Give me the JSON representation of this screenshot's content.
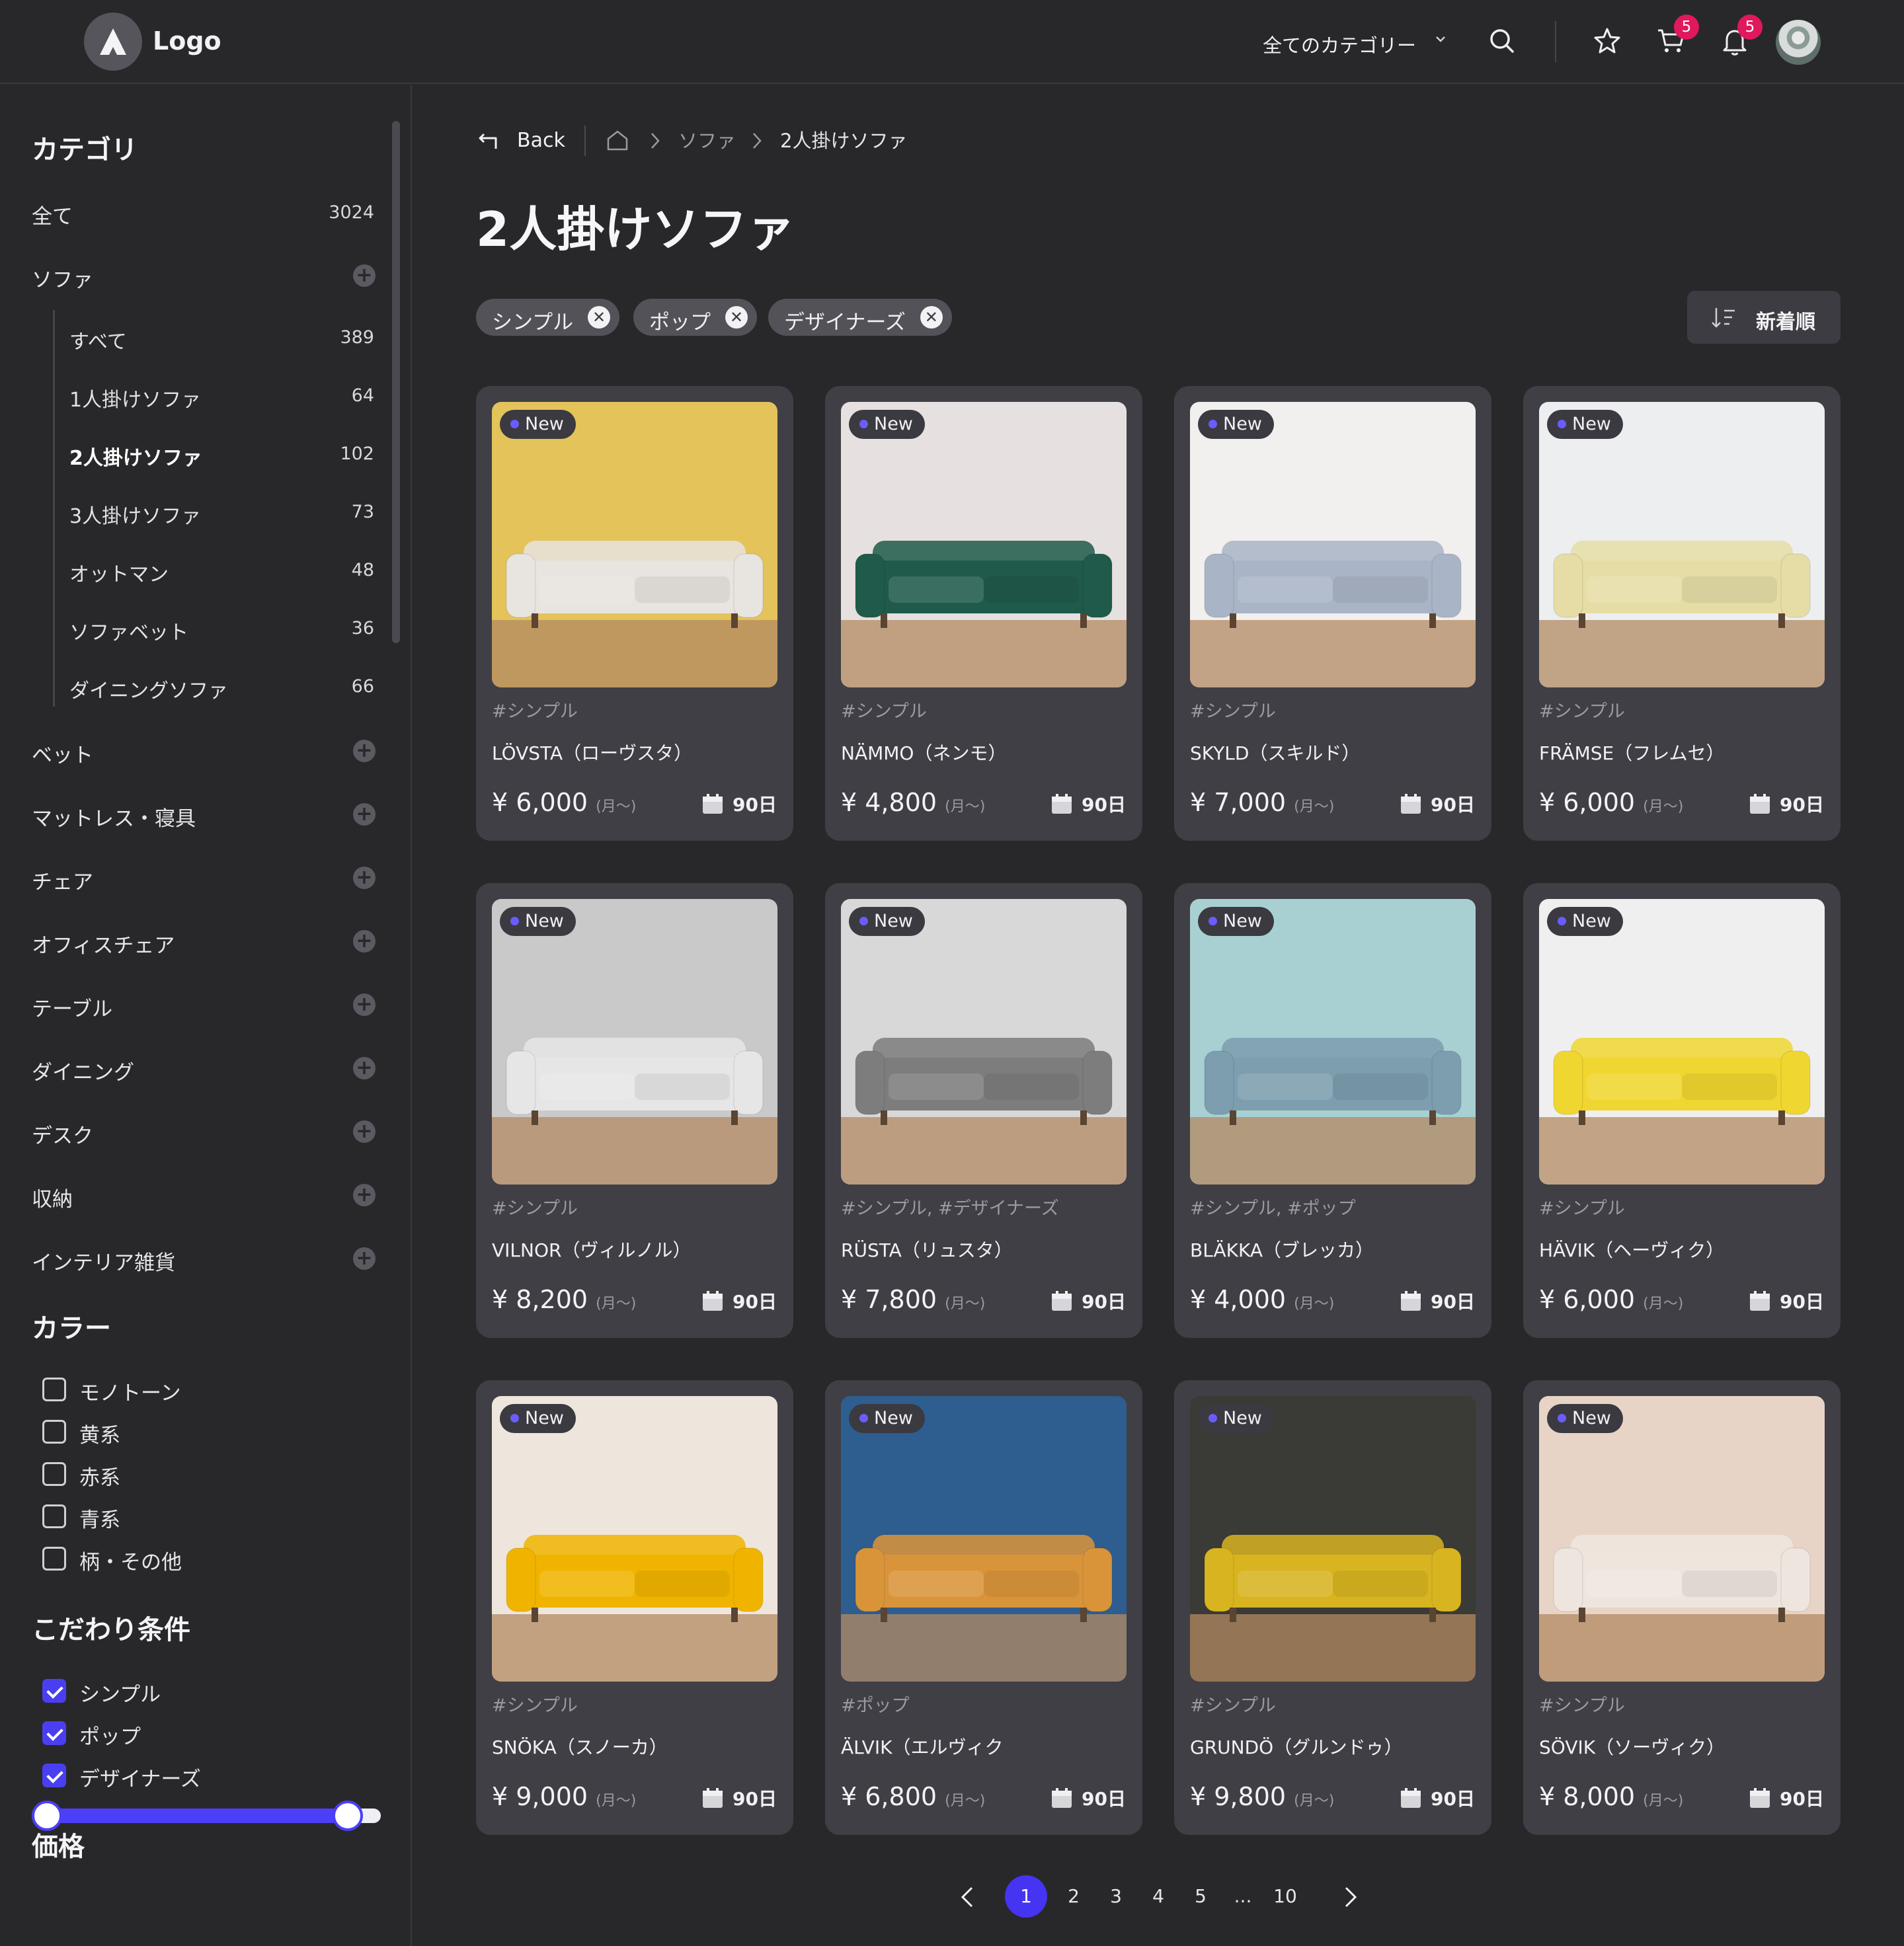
{
  "header": {
    "logo_text": "Logo",
    "category_select": "全てのカテゴリー",
    "cart_badge": "5",
    "notification_badge": "5"
  },
  "breadcrumb": {
    "back_label": "Back",
    "items": [
      "ソファ",
      "2人掛けソファ"
    ]
  },
  "page_title": "2人掛けソファ",
  "active_filters": [
    "シンプル",
    "ポップ",
    "デザイナーズ"
  ],
  "sort_label": "新着順",
  "sidebar": {
    "category_title": "カテゴリ",
    "all": {
      "label": "全て",
      "count": "3024"
    },
    "sofa": {
      "label": "ソファ"
    },
    "sofa_children": [
      {
        "label": "すべて",
        "count": "389"
      },
      {
        "label": "1人掛けソファ",
        "count": "64"
      },
      {
        "label": "2人掛けソファ",
        "count": "102"
      },
      {
        "label": "3人掛けソファ",
        "count": "73"
      },
      {
        "label": "オットマン",
        "count": "48"
      },
      {
        "label": "ソファベット",
        "count": "36"
      },
      {
        "label": "ダイニングソファ",
        "count": "66"
      }
    ],
    "other_categories": [
      "ベット",
      "マットレス・寝具",
      "チェア",
      "オフィスチェア",
      "テーブル",
      "ダイニング",
      "デスク",
      "収納",
      "インテリア雑貨"
    ],
    "color_title": "カラー",
    "colors": [
      "モノトーン",
      "黄系",
      "赤系",
      "青系",
      "柄・その他"
    ],
    "preference_title": "こだわり条件",
    "preferences": [
      "シンプル",
      "ポップ",
      "デザイナーズ"
    ],
    "price_title": "価格",
    "price_range": [
      0,
      0.92
    ]
  },
  "card_badge": "New",
  "price_unit": "(月〜)",
  "products": [
    {
      "tag": "#シンプル",
      "name": "LÖVSTA（ローヴスタ）",
      "price": "¥ 6,000",
      "days": "90日",
      "bg": "#e3c35a",
      "sofa": "#e8e4e0"
    },
    {
      "tag": "#シンプル",
      "name": "NÄMMO（ネンモ）",
      "price": "¥ 4,800",
      "days": "90日",
      "bg": "#e6e1e0",
      "sofa": "#1f5a4a"
    },
    {
      "tag": "#シンプル",
      "name": "SKYLD（スキルド）",
      "price": "¥ 7,000",
      "days": "90日",
      "bg": "#f2f0ee",
      "sofa": "#a9b4c6"
    },
    {
      "tag": "#シンプル",
      "name": "FRÄMSE（フレムセ）",
      "price": "¥ 6,000",
      "days": "90日",
      "bg": "#eceef0",
      "sofa": "#e6dda6"
    },
    {
      "tag": "#シンプル",
      "name": "VILNOR（ヴィルノル）",
      "price": "¥ 8,200",
      "days": "90日",
      "bg": "#c9c9c9",
      "sofa": "#e6e6e6"
    },
    {
      "tag": "#シンプル, #デザイナーズ",
      "name": "RÜSTA（リュスタ）",
      "price": "¥ 7,800",
      "days": "90日",
      "bg": "#d8d8d8",
      "sofa": "#7d7d7d"
    },
    {
      "tag": "#シンプル, #ポップ",
      "name": "BLÄKKA（ブレッカ）",
      "price": "¥ 4,000",
      "days": "90日",
      "bg": "#a8d0d2",
      "sofa": "#7c9eae"
    },
    {
      "tag": "#シンプル",
      "name": "HÄVIK（ヘーヴィク）",
      "price": "¥ 6,000",
      "days": "90日",
      "bg": "#efefef",
      "sofa": "#f0d630"
    },
    {
      "tag": "#シンプル",
      "name": "SNÖKA（スノーカ）",
      "price": "¥ 9,000",
      "days": "90日",
      "bg": "#eee6dc",
      "sofa": "#f0b400"
    },
    {
      "tag": "#ポップ",
      "name": "ÄLVIK（エルヴィク",
      "price": "¥ 6,800",
      "days": "90日",
      "bg": "#2e5d8f",
      "sofa": "#d9943a"
    },
    {
      "tag": "#シンプル",
      "name": "GRUNDÖ（グルンドゥ）",
      "price": "¥ 9,800",
      "days": "90日",
      "bg": "#3a3a36",
      "sofa": "#d8b420"
    },
    {
      "tag": "#シンプル",
      "name": "SÖVIK（ソーヴィク）",
      "price": "¥ 8,000",
      "days": "90日",
      "bg": "#e8d4c6",
      "sofa": "#eee6de"
    }
  ],
  "pagination": {
    "pages": [
      "1",
      "2",
      "3",
      "4",
      "5",
      "...",
      "10"
    ],
    "current": "1"
  }
}
